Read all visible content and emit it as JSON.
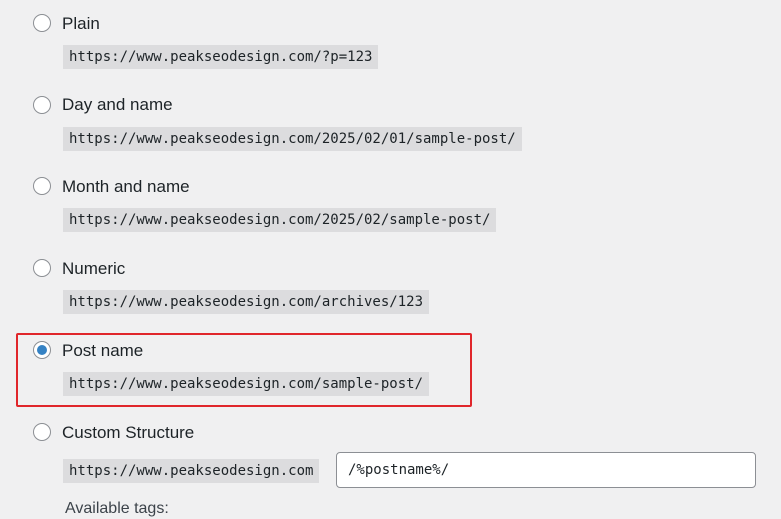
{
  "options": [
    {
      "label": "Plain",
      "example": "https://www.peakseodesign.com/?p=123",
      "selected": false
    },
    {
      "label": "Day and name",
      "example": "https://www.peakseodesign.com/2025/02/01/sample-post/",
      "selected": false
    },
    {
      "label": "Month and name",
      "example": "https://www.peakseodesign.com/2025/02/sample-post/",
      "selected": false
    },
    {
      "label": "Numeric",
      "example": "https://www.peakseodesign.com/archives/123",
      "selected": false
    },
    {
      "label": "Post name",
      "example": "https://www.peakseodesign.com/sample-post/",
      "selected": true
    },
    {
      "label": "Custom Structure",
      "example": "https://www.peakseodesign.com",
      "selected": false
    }
  ],
  "custom": {
    "value": "/%postname%/"
  },
  "available_tags_label": "Available tags:",
  "colors": {
    "highlight_border": "#e0262b",
    "radio_checked": "#3582c4",
    "code_background": "#dcdcde",
    "page_background": "#f0f0f1"
  }
}
